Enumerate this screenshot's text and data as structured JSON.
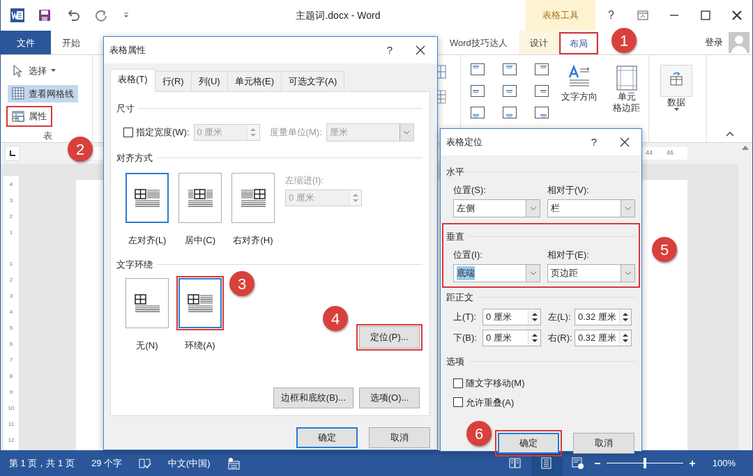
{
  "window": {
    "title": "主题词.docx - Word",
    "context_group": "表格工具",
    "help": "?"
  },
  "ribbon_tabs": [
    {
      "label": "文件",
      "kind": "file",
      "selected": false,
      "highlighted": false
    },
    {
      "label": "开始",
      "kind": "plain",
      "selected": false,
      "highlighted": false
    },
    {
      "label": "Word技巧达人",
      "kind": "plain",
      "selected": false,
      "highlighted": false
    },
    {
      "label": "设计",
      "kind": "context",
      "selected": false,
      "highlighted": false
    },
    {
      "label": "布局",
      "kind": "context",
      "selected": true,
      "highlighted": true
    }
  ],
  "account": {
    "label": "登录"
  },
  "table_group": {
    "label": "表",
    "items": [
      {
        "label": "选择",
        "kind": "dropdown",
        "on": false,
        "highlighted": false
      },
      {
        "label": "查看网格线",
        "kind": "toggle",
        "on": true,
        "highlighted": false
      },
      {
        "label": "属性",
        "kind": "command",
        "on": false,
        "highlighted": true
      }
    ]
  },
  "layout_buttons": [
    {
      "lines": [
        "文字方向"
      ],
      "kind": "text-direction"
    },
    {
      "lines": [
        "单元",
        "格边距"
      ],
      "kind": "cell-margins"
    },
    {
      "lines": [
        "数据"
      ],
      "kind": "data"
    }
  ],
  "ruler": {
    "labels": [
      "44",
      "46"
    ]
  },
  "vertical_ruler": {
    "labels": [
      "4",
      "3",
      "2",
      "1",
      "1",
      "2",
      "3",
      "4",
      "5",
      "6",
      "7",
      "8",
      "9",
      "10",
      "11",
      "12"
    ]
  },
  "table_properties": {
    "title": "表格属性",
    "help": "?",
    "tabs": [
      {
        "label": "表格(T)",
        "selected": true
      },
      {
        "label": "行(R)",
        "selected": false
      },
      {
        "label": "列(U)",
        "selected": false
      },
      {
        "label": "单元格(E)",
        "selected": false
      },
      {
        "label": "可选文字(A)",
        "selected": false
      }
    ],
    "size": {
      "heading": "尺寸",
      "width_checkbox": {
        "label": "指定宽度(W):",
        "checked": false
      },
      "width": {
        "value": "0 厘米",
        "disabled": true
      },
      "unit_label": "度量单位(M):",
      "unit": {
        "value": "厘米",
        "disabled": true
      }
    },
    "alignment": {
      "heading": "对齐方式",
      "options": [
        {
          "label": "左对齐(L)",
          "kind": "left",
          "selected": true,
          "highlighted": false
        },
        {
          "label": "居中(C)",
          "kind": "center",
          "selected": false,
          "highlighted": false
        },
        {
          "label": "右对齐(H)",
          "kind": "right",
          "selected": false,
          "highlighted": false
        }
      ],
      "indent_label": "左缩进(I):",
      "indent": {
        "value": "0 厘米",
        "disabled": true
      }
    },
    "wrapping": {
      "heading": "文字环绕",
      "options": [
        {
          "label": "无(N)",
          "kind": "none",
          "selected": false,
          "highlighted": false
        },
        {
          "label": "环绕(A)",
          "kind": "around",
          "selected": true,
          "highlighted": true
        }
      ]
    },
    "position_button": {
      "label": "定位(P)...",
      "highlighted": true
    },
    "buttons": [
      {
        "label": "边框和底纹(B)..."
      },
      {
        "label": "选项(O)..."
      }
    ],
    "footer": [
      {
        "label": "确定",
        "default": true,
        "highlighted": false
      },
      {
        "label": "取消",
        "default": false,
        "highlighted": false
      }
    ]
  },
  "table_positioning": {
    "title": "表格定位",
    "help": "?",
    "horizontal": {
      "heading": "水平",
      "highlighted": false,
      "fields": [
        {
          "label": "位置(S):",
          "value": "左侧",
          "text_selected": false
        },
        {
          "label": "相对于(V):",
          "value": "栏",
          "text_selected": false
        }
      ]
    },
    "vertical": {
      "heading": "垂直",
      "highlighted": true,
      "fields": [
        {
          "label": "位置(I):",
          "value": "底端",
          "text_selected": true
        },
        {
          "label": "相对于(E):",
          "value": "页边距",
          "text_selected": false
        }
      ]
    },
    "distance": {
      "heading": "距正文",
      "fields": [
        {
          "label": "上(T):",
          "value": "0 厘米"
        },
        {
          "label": "左(L):",
          "value": "0.32 厘米"
        },
        {
          "label": "下(B):",
          "value": "0 厘米"
        },
        {
          "label": "右(R):",
          "value": "0.32 厘米"
        }
      ]
    },
    "options": {
      "heading": "选项",
      "checkboxes": [
        {
          "label": "随文字移动(M)",
          "checked": false
        },
        {
          "label": "允许重叠(A)",
          "checked": false
        }
      ]
    },
    "footer": [
      {
        "label": "确定",
        "default": true,
        "highlighted": true
      },
      {
        "label": "取消",
        "default": false,
        "highlighted": false
      }
    ]
  },
  "callouts": [
    "1",
    "2",
    "3",
    "4",
    "5",
    "6"
  ],
  "status_bar": {
    "page": "第 1 页，共 1 页",
    "words": "29 个字",
    "language": "中文(中国)",
    "views": [
      {
        "kind": "read",
        "selected": false
      },
      {
        "kind": "print",
        "selected": true
      },
      {
        "kind": "web",
        "selected": false
      }
    ],
    "zoom": {
      "level": 0.5,
      "reading": "100%"
    }
  }
}
